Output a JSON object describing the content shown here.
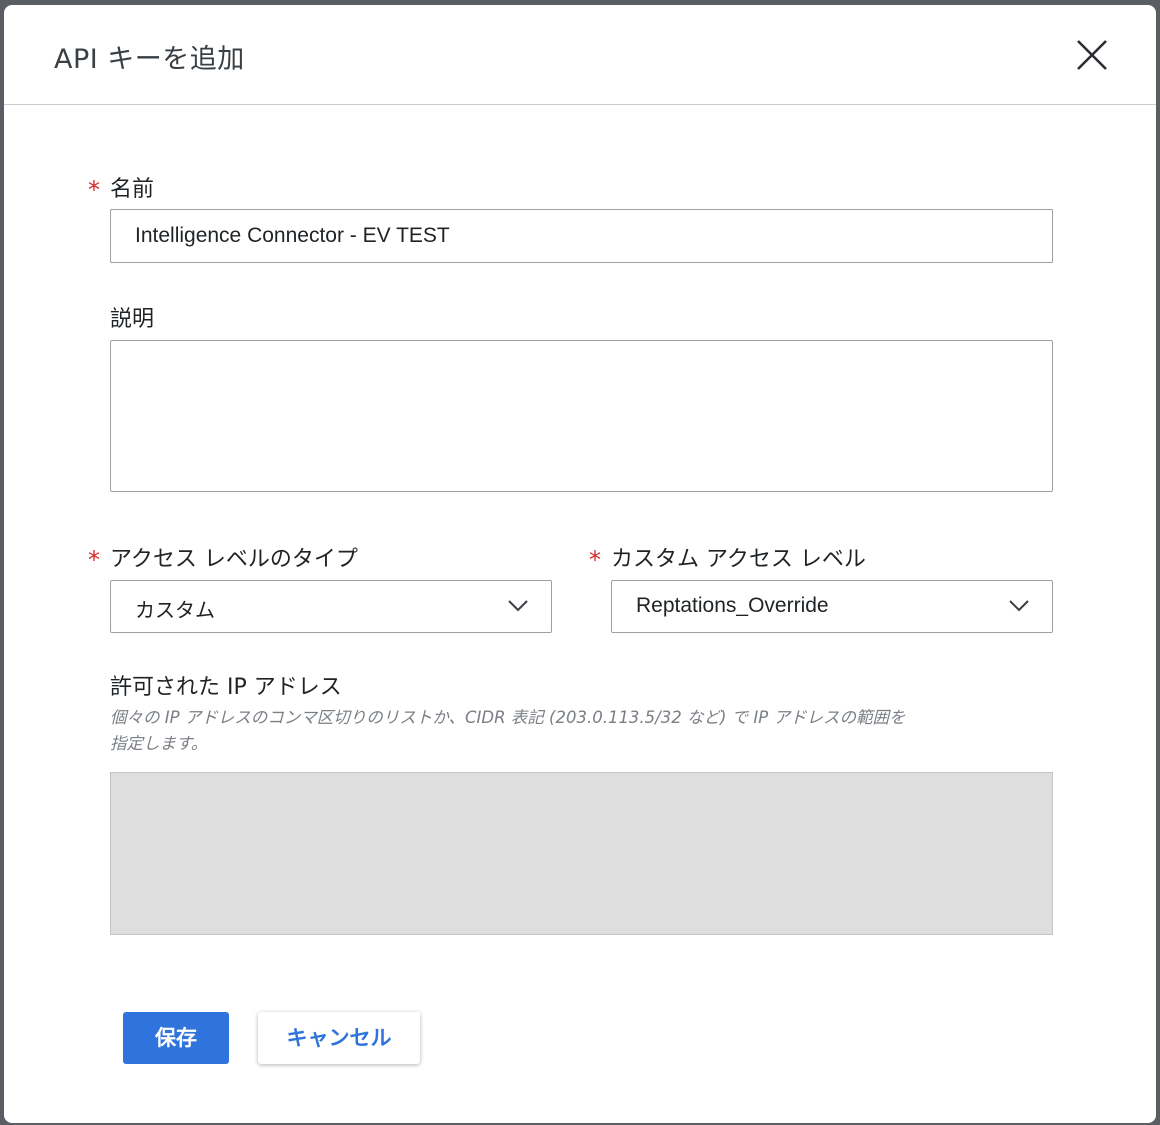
{
  "dialog": {
    "title": "API キーを追加",
    "close_icon": "close-icon"
  },
  "form": {
    "name": {
      "label": "名前",
      "required_mark": "*",
      "value": "Intelligence Connector - EV TEST"
    },
    "description": {
      "label": "説明",
      "value": ""
    },
    "access_level_type": {
      "label": "アクセス レベルのタイプ",
      "required_mark": "*",
      "selected": "カスタム",
      "icon": "chevron-down-icon"
    },
    "custom_access_level": {
      "label": "カスタム アクセス レベル",
      "required_mark": "*",
      "selected": "Reptations_Override",
      "icon": "chevron-down-icon"
    },
    "allowed_ips": {
      "label": "許可された IP アドレス",
      "hint": "個々の IP アドレスのコンマ区切りのリストか、CIDR 表記 (203.0.113.5/32 など) で IP アドレスの範囲を指定します。",
      "value": "",
      "disabled": true
    }
  },
  "actions": {
    "save_label": "保存",
    "cancel_label": "キャンセル"
  },
  "colors": {
    "primary": "#2f74dc",
    "required": "#d62a2a",
    "disabled_bg": "#dedede"
  }
}
